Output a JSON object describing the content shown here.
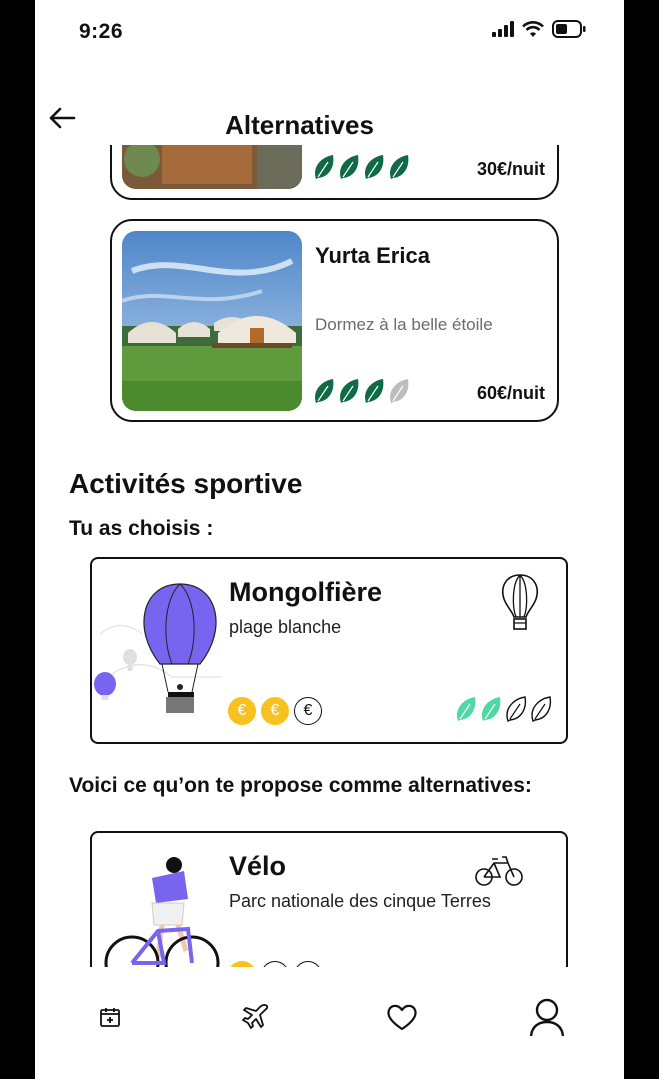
{
  "status": {
    "time": "9:26"
  },
  "header": {
    "title": "Alternatives"
  },
  "lodgings": [
    {
      "name": "",
      "subtitle": "",
      "price": "30€/nuit",
      "eco_score": 4
    },
    {
      "name": "Yurta Erica",
      "subtitle": "Dormez à la belle étoile",
      "price": "60€/nuit",
      "eco_score": 3
    }
  ],
  "activities": {
    "title": "Activités sportive",
    "chosen_label": "Tu as choisis :",
    "chosen": {
      "name": "Mongolfière",
      "subtitle": "plage blanche",
      "price_level": 2,
      "eco_score": 2,
      "icon": "hot-air-balloon-icon"
    },
    "alternatives_label": "Voici ce qu’on te propose comme alternatives:",
    "alternatives": [
      {
        "name": "Vélo",
        "subtitle": "Parc nationale des cinque Terres",
        "price_level": 1,
        "icon": "bicycle-icon"
      }
    ]
  },
  "nav": [
    {
      "icon": "calendar-add-icon"
    },
    {
      "icon": "airplane-icon"
    },
    {
      "icon": "heart-icon"
    },
    {
      "icon": "user-icon"
    }
  ],
  "colors": {
    "leaf_dark": "#0e6b45",
    "leaf_light": "#4fd8a3",
    "leaf_empty": "#bdbdbd",
    "coin": "#f7c21f",
    "balloon": "#7765f0"
  }
}
